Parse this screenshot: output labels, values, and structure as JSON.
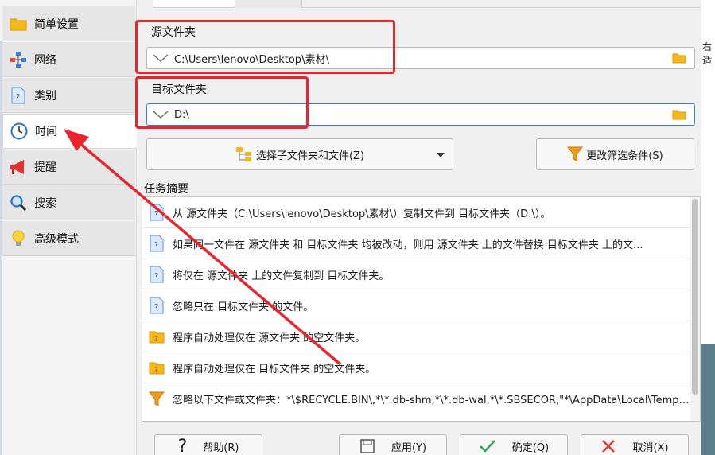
{
  "sidebar": {
    "items": [
      {
        "label": "简单设置",
        "icon": "folder-icon"
      },
      {
        "label": "网络",
        "icon": "network-icon"
      },
      {
        "label": "类别",
        "icon": "document-icon"
      },
      {
        "label": "时间",
        "icon": "clock-icon"
      },
      {
        "label": "提醒",
        "icon": "megaphone-icon"
      },
      {
        "label": "搜索",
        "icon": "magnifier-icon"
      },
      {
        "label": "高级模式",
        "icon": "lightbulb-icon"
      }
    ]
  },
  "source": {
    "label": "源文件夹",
    "value": "C:\\Users\\lenovo\\Desktop\\素材\\"
  },
  "target": {
    "label": "目标文件夹",
    "value": "D:\\"
  },
  "buttons": {
    "select_subfolders": "选择子文件夹和文件(Z)",
    "change_filter": "更改筛选条件(S)"
  },
  "summary": {
    "title": "任务摘要",
    "rows": [
      {
        "text": "从 源文件夹（C:\\Users\\lenovo\\Desktop\\素材\\）复制文件到 目标文件夹（D:\\）。",
        "icon": "info-doc-icon"
      },
      {
        "text": "如果同一文件在 源文件夹 和 目标文件夹 均被改动，则用 源文件夹 上的文件替换 目标文件夹 上的文...",
        "icon": "info-doc-icon"
      },
      {
        "text": "将仅在 源文件夹 上的文件复制到 目标文件夹。",
        "icon": "info-doc-icon"
      },
      {
        "text": "忽略只在 目标文件夹 的文件。",
        "icon": "info-doc-icon"
      },
      {
        "text": "程序自动处理仅在 源文件夹 的空文件夹。",
        "icon": "info-folder-icon"
      },
      {
        "text": "程序自动处理仅在 目标文件夹 的空文件夹。",
        "icon": "info-folder-icon"
      },
      {
        "text": "忽略以下文件或文件夹：*\\$RECYCLE.BIN\\,*\\*.db-shm,*\\*.db-wal,*\\*.SBSECOR,\"*\\AppData\\Local\\Temporar...",
        "icon": "filter-icon"
      }
    ]
  },
  "footer": {
    "help": "帮助(R)",
    "apply": "应用(Y)",
    "ok": "确定(Q)",
    "cancel": "取消(X)"
  },
  "right_edge_text": "右适"
}
